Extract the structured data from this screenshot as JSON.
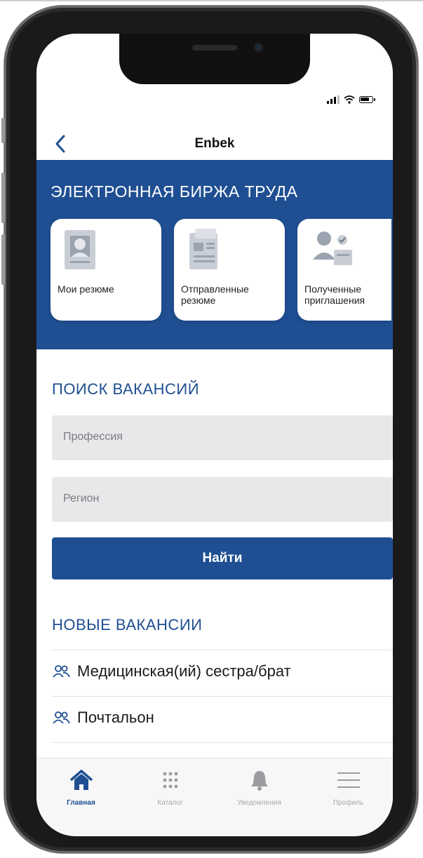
{
  "app": {
    "title": "Enbek",
    "status": {
      "signal": "signal-icon",
      "wifi": "wifi-icon",
      "battery": "battery-icon"
    }
  },
  "hero": {
    "title": "ЭЛЕКТРОННАЯ БИРЖА ТРУДА",
    "cards": [
      {
        "label": "Мои резюме",
        "icon": "resume-icon"
      },
      {
        "label": "Отправленные резюме",
        "icon": "sent-resume-icon"
      },
      {
        "label": "Полученные приглашения",
        "icon": "invitations-icon"
      }
    ]
  },
  "search": {
    "title": "ПОИСК ВАКАНСИЙ",
    "profession_placeholder": "Профессия",
    "region_placeholder": "Регион",
    "find_label": "Найти"
  },
  "vacancies": {
    "title": "НОВЫЕ ВАКАНСИИ",
    "items": [
      {
        "label": "Медицинская(ий) сестра/брат"
      },
      {
        "label": "Почтальон"
      }
    ]
  },
  "tabs": [
    {
      "label": "Главная",
      "icon": "home-icon",
      "active": true
    },
    {
      "label": "Каталог",
      "icon": "grid-icon",
      "active": false
    },
    {
      "label": "Уведомления",
      "icon": "bell-icon",
      "active": false
    },
    {
      "label": "Профиль",
      "icon": "menu-icon",
      "active": false
    }
  ],
  "colors": {
    "accent": "#1f4f92",
    "field": "#e8e8ea",
    "tab_inactive": "#a7a7aa"
  }
}
